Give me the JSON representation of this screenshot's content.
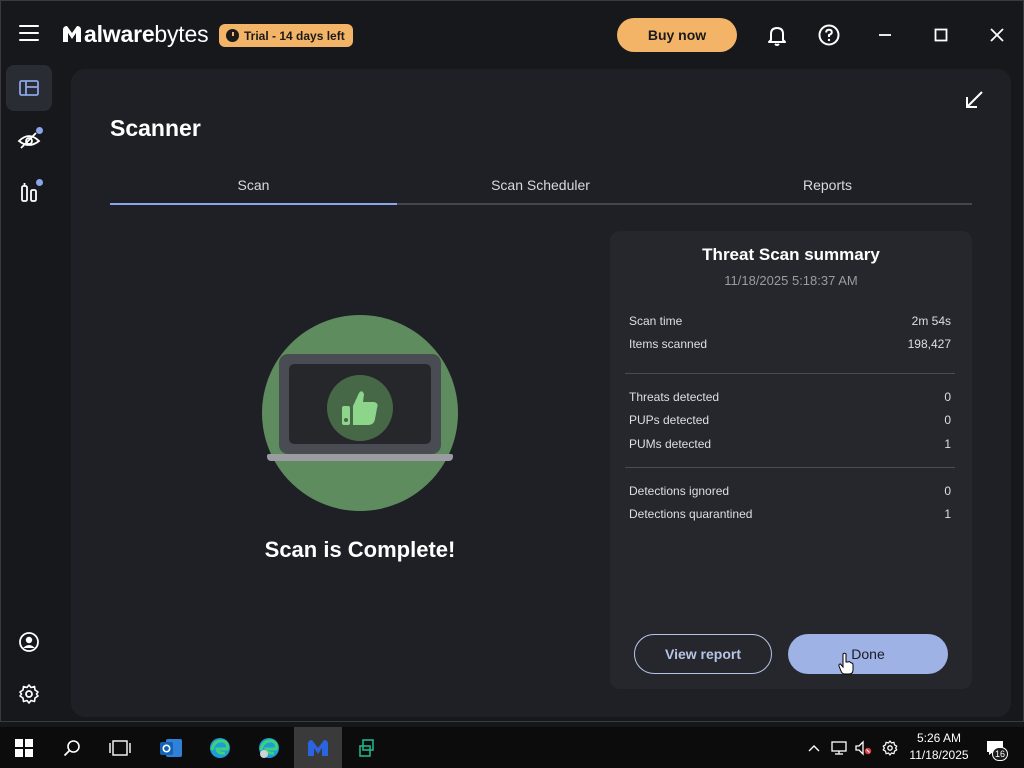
{
  "app": {
    "name_light": "M",
    "name_bold": "alwarebytes",
    "name_bold_part": "alware",
    "name_rest": "bytes",
    "trial_badge": "Trial - 14 days left",
    "buy_label": "Buy now"
  },
  "page": {
    "title": "Scanner",
    "tabs": [
      {
        "label": "Scan",
        "active": true
      },
      {
        "label": "Scan Scheduler",
        "active": false
      },
      {
        "label": "Reports",
        "active": false
      }
    ]
  },
  "scan": {
    "status": "Scan is Complete!"
  },
  "summary": {
    "title": "Threat Scan summary",
    "datetime": "11/18/2025 5:18:37 AM",
    "group1": [
      {
        "label": "Scan time",
        "value": "2m 54s"
      },
      {
        "label": "Items scanned",
        "value": "198,427"
      }
    ],
    "group2": [
      {
        "label": "Threats detected",
        "value": "0"
      },
      {
        "label": "PUPs detected",
        "value": "0"
      },
      {
        "label": "PUMs detected",
        "value": "1"
      }
    ],
    "group3": [
      {
        "label": "Detections ignored",
        "value": "0"
      },
      {
        "label": "Detections quarantined",
        "value": "1"
      }
    ],
    "view_report_label": "View report",
    "done_label": "Done"
  },
  "taskbar": {
    "time": "5:26 AM",
    "date": "11/18/2025",
    "notification_count": "16"
  },
  "colors": {
    "accent": "#8aa6e8",
    "brand_orange": "#f4b467",
    "success_green": "#5e8c5f"
  }
}
